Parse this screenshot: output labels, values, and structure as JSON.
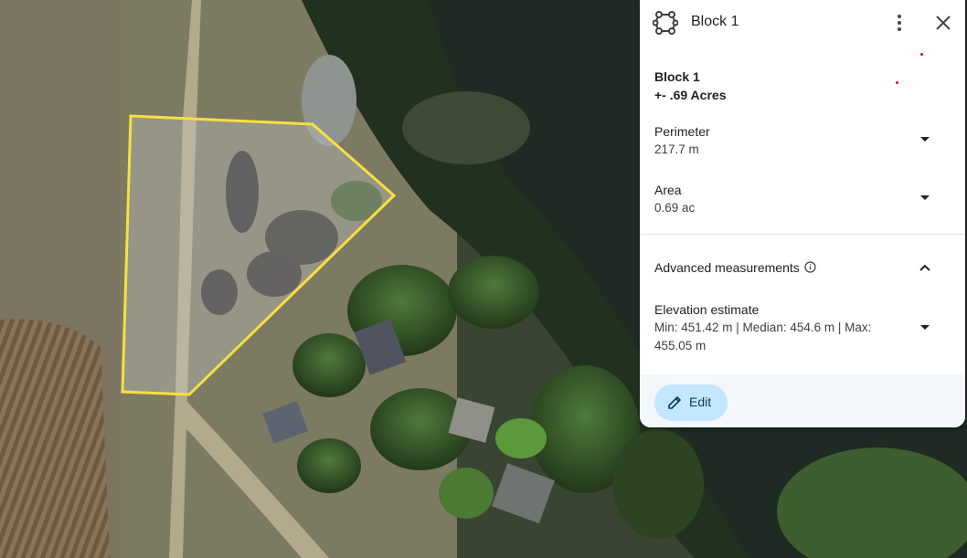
{
  "panel": {
    "title": "Block 1",
    "description_line1": "Block 1",
    "description_line2": "+- .69 Acres",
    "perimeter": {
      "label": "Perimeter",
      "value": "217.7 m"
    },
    "area": {
      "label": "Area",
      "value": "0.69 ac"
    },
    "advanced": {
      "label": "Advanced measurements"
    },
    "elevation": {
      "label": "Elevation estimate",
      "value": "Min: 451.42 m | Median: 454.6 m | Max: 455.05 m"
    },
    "edit_label": "Edit"
  },
  "map": {
    "polygon_color": "#f5e042"
  },
  "colors": {
    "accent_button": "#c2e7ff",
    "footer_bg": "#f3f6fb"
  }
}
